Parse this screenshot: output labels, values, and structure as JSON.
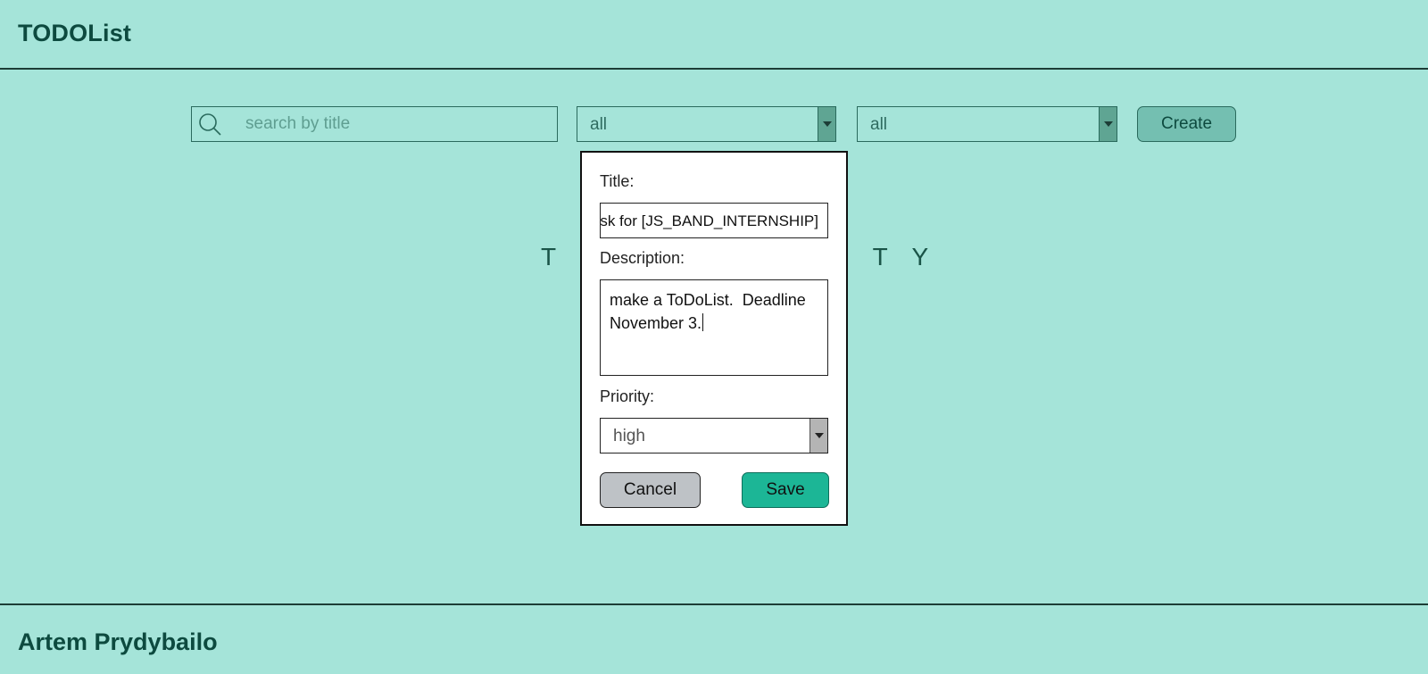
{
  "header": {
    "title": "TODOList"
  },
  "toolbar": {
    "search_placeholder": "search by title",
    "status_filter": {
      "selected": "all"
    },
    "priority_filter": {
      "selected": "all"
    },
    "create_label": "Create"
  },
  "main": {
    "empty_message": "THE LIST IS EMPTY",
    "empty_visible_left": "T H",
    "empty_visible_right": "T Y"
  },
  "modal": {
    "title_label": "Title:",
    "title_value": "Task for [JS_BAND_INTERNSHIP]",
    "title_visible": "ask for [JS_BAND_INTERNSHIP]",
    "description_label": "Description:",
    "description_value": "make a ToDoList.  Deadline November 3.",
    "priority_label": "Priority:",
    "priority_selected": "high",
    "cancel_label": "Cancel",
    "save_label": "Save"
  },
  "footer": {
    "author": "Artem Prydybailo"
  },
  "colors": {
    "background": "#a5e4d9",
    "text": "#0d4a3f",
    "save_button": "#1cb696",
    "cancel_button": "#bec2c6",
    "create_button": "#74bfb1"
  },
  "icons": {
    "search": "search-icon",
    "dropdown": "chevron-down-icon"
  }
}
